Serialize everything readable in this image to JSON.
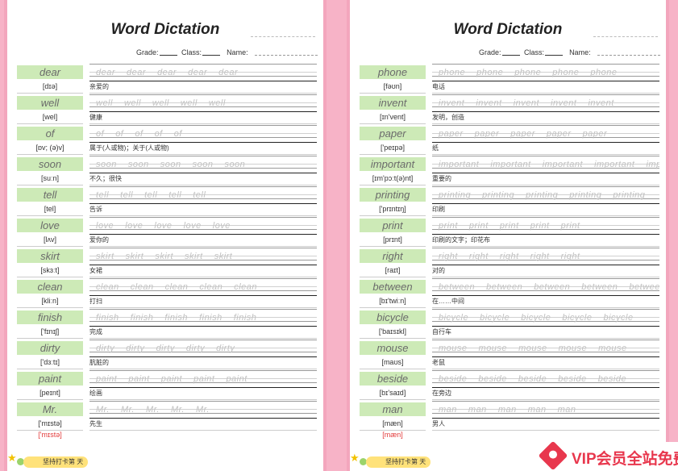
{
  "left_page": {
    "title": "Word Dictation",
    "grade_label": "Grade:",
    "class_label": "Class:",
    "name_label": "Name:",
    "entries": [
      {
        "word": "dear",
        "phonetic": "[dɪə]",
        "meaning": "亲爱的"
      },
      {
        "word": "well",
        "phonetic": "[wel]",
        "meaning": "健康"
      },
      {
        "word": "of",
        "phonetic": "[ɒv; (ə)v]",
        "meaning": "属于(人或物)；关于(人或物)"
      },
      {
        "word": "soon",
        "phonetic": "[suːn]",
        "meaning": "不久；很快"
      },
      {
        "word": "tell",
        "phonetic": "[tel]",
        "meaning": "告诉"
      },
      {
        "word": "love",
        "phonetic": "[lʌv]",
        "meaning": "爱你的"
      },
      {
        "word": "skirt",
        "phonetic": "[skɜːt]",
        "meaning": "女裙"
      },
      {
        "word": "clean",
        "phonetic": "[kliːn]",
        "meaning": "打扫"
      },
      {
        "word": "finish",
        "phonetic": "['fɪnɪʃ]",
        "meaning": "完成"
      },
      {
        "word": "dirty",
        "phonetic": "['dɜːtɪ]",
        "meaning": "肮脏的"
      },
      {
        "word": "paint",
        "phonetic": "[peɪnt]",
        "meaning": "绘画"
      },
      {
        "word": "Mr.",
        "phonetic": "['mɪstə]",
        "meaning": "先生"
      }
    ],
    "extra_phonetic": "['mɪstə]",
    "badge": "坚持打卡第   天"
  },
  "right_page": {
    "title": "Word Dictation",
    "grade_label": "Grade:",
    "class_label": "Class:",
    "name_label": "Name:",
    "entries": [
      {
        "word": "phone",
        "phonetic": "[fəʊn]",
        "meaning": "电话"
      },
      {
        "word": "invent",
        "phonetic": "[ɪn'vent]",
        "meaning": "发明，创造"
      },
      {
        "word": "paper",
        "phonetic": "['peɪpə]",
        "meaning": "纸"
      },
      {
        "word": "important",
        "phonetic": "[ɪm'pɔːt(ə)nt]",
        "meaning": "重要的"
      },
      {
        "word": "printing",
        "phonetic": "['prɪntɪŋ]",
        "meaning": "印刷"
      },
      {
        "word": "print",
        "phonetic": "[prɪnt]",
        "meaning": "印刷的文字；印花布"
      },
      {
        "word": "right",
        "phonetic": "[raɪt]",
        "meaning": "对的"
      },
      {
        "word": "between",
        "phonetic": "[bɪ'twiːn]",
        "meaning": "在……中间"
      },
      {
        "word": "bicycle",
        "phonetic": "['baɪsɪkl]",
        "meaning": "自行车"
      },
      {
        "word": "mouse",
        "phonetic": "[maʊs]",
        "meaning": "老鼠"
      },
      {
        "word": "beside",
        "phonetic": "[bɪ'saɪd]",
        "meaning": "在旁边"
      },
      {
        "word": "man",
        "phonetic": "[mæn]",
        "meaning": "男人"
      }
    ],
    "extra_phonetic": "[mæn]",
    "badge": "坚持打卡第   天"
  },
  "watermark": "VIP会员全站免费",
  "colors": {
    "background": "#f7b3c7",
    "word_bg": "#cdeab7",
    "accent_red": "#e23b3b",
    "badge": "#ffe27a",
    "vip_red": "#e8374d"
  }
}
